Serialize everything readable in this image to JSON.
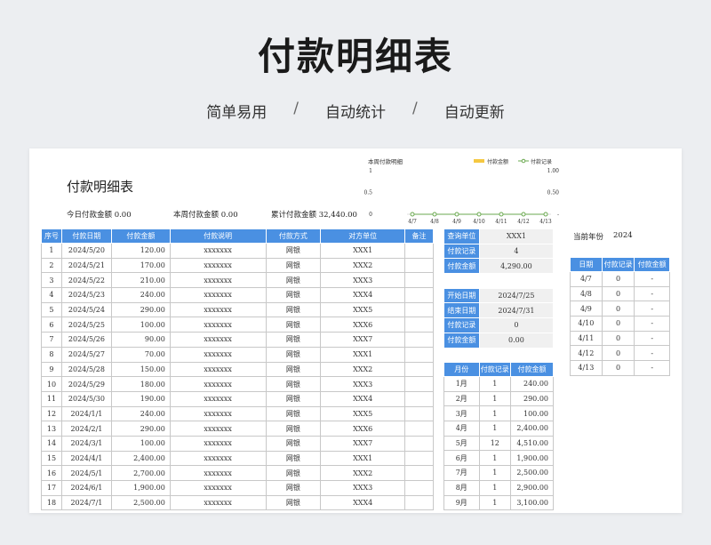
{
  "hero": {
    "title": "付款明细表"
  },
  "subtitle": {
    "items": [
      "简单易用",
      "自动统计",
      "自动更新"
    ],
    "sep": "/"
  },
  "sheet": {
    "title": "付款明细表",
    "stats": {
      "today": "今日付款金额 0.00",
      "week": "本周付款金额 0.00",
      "total": "累计付款金额 32,440.00"
    },
    "chart": {
      "title": "本周付款明细",
      "legend_amount": "付款金额",
      "legend_records": "付款记录",
      "left_ticks": [
        "1",
        "0.5",
        "0"
      ],
      "right_ticks": [
        "1.00",
        "0.50",
        "-"
      ],
      "colors": {
        "amount": "#f5c842",
        "records": "#6aa84f"
      }
    },
    "chart_data": {
      "type": "line",
      "categories": [
        "4/7",
        "4/8",
        "4/9",
        "4/10",
        "4/11",
        "4/12",
        "4/13"
      ],
      "series": [
        {
          "name": "付款金额",
          "values": [
            0,
            0,
            0,
            0,
            0,
            0,
            0
          ]
        },
        {
          "name": "付款记录",
          "values": [
            0,
            0,
            0,
            0,
            0,
            0,
            0
          ]
        }
      ],
      "title": "本周付款明细",
      "ylim": [
        0,
        1
      ]
    },
    "main_table": {
      "headers": [
        "序号",
        "付款日期",
        "付款金额",
        "付款说明",
        "付款方式",
        "对方单位",
        "备注"
      ],
      "rows": [
        [
          "1",
          "2024/5/20",
          "120.00",
          "xxxxxxx",
          "网银",
          "XXX1",
          ""
        ],
        [
          "2",
          "2024/5/21",
          "170.00",
          "xxxxxxx",
          "网银",
          "XXX2",
          ""
        ],
        [
          "3",
          "2024/5/22",
          "210.00",
          "xxxxxxx",
          "网银",
          "XXX3",
          ""
        ],
        [
          "4",
          "2024/5/23",
          "240.00",
          "xxxxxxx",
          "网银",
          "XXX4",
          ""
        ],
        [
          "5",
          "2024/5/24",
          "290.00",
          "xxxxxxx",
          "网银",
          "XXX5",
          ""
        ],
        [
          "6",
          "2024/5/25",
          "100.00",
          "xxxxxxx",
          "网银",
          "XXX6",
          ""
        ],
        [
          "7",
          "2024/5/26",
          "90.00",
          "xxxxxxx",
          "网银",
          "XXX7",
          ""
        ],
        [
          "8",
          "2024/5/27",
          "70.00",
          "xxxxxxx",
          "网银",
          "XXX1",
          ""
        ],
        [
          "9",
          "2024/5/28",
          "150.00",
          "xxxxxxx",
          "网银",
          "XXX2",
          ""
        ],
        [
          "10",
          "2024/5/29",
          "180.00",
          "xxxxxxx",
          "网银",
          "XXX3",
          ""
        ],
        [
          "11",
          "2024/5/30",
          "190.00",
          "xxxxxxx",
          "网银",
          "XXX4",
          ""
        ],
        [
          "12",
          "2024/1/1",
          "240.00",
          "xxxxxxx",
          "网银",
          "XXX5",
          ""
        ],
        [
          "13",
          "2024/2/1",
          "290.00",
          "xxxxxxx",
          "网银",
          "XXX6",
          ""
        ],
        [
          "14",
          "2024/3/1",
          "100.00",
          "xxxxxxx",
          "网银",
          "XXX7",
          ""
        ],
        [
          "15",
          "2024/4/1",
          "2,400.00",
          "xxxxxxx",
          "网银",
          "XXX1",
          ""
        ],
        [
          "16",
          "2024/5/1",
          "2,700.00",
          "xxxxxxx",
          "网银",
          "XXX2",
          ""
        ],
        [
          "17",
          "2024/6/1",
          "1,900.00",
          "xxxxxxx",
          "网银",
          "XXX3",
          ""
        ],
        [
          "18",
          "2024/7/1",
          "2,500.00",
          "xxxxxxx",
          "网银",
          "XXX4",
          ""
        ]
      ]
    },
    "query": {
      "rows": [
        [
          "查询单位",
          "XXX1"
        ],
        [
          "付款记录",
          "4"
        ],
        [
          "付款金额",
          "4,290.00"
        ],
        [
          "",
          ""
        ],
        [
          "开始日期",
          "2024/7/25"
        ],
        [
          "结束日期",
          "2024/7/31"
        ],
        [
          "付款记录",
          "0"
        ],
        [
          "付款金额",
          "0.00"
        ]
      ]
    },
    "monthly": {
      "headers": [
        "月份",
        "付款记录",
        "付款金额"
      ],
      "rows": [
        [
          "1月",
          "1",
          "240.00"
        ],
        [
          "2月",
          "1",
          "290.00"
        ],
        [
          "3月",
          "1",
          "100.00"
        ],
        [
          "4月",
          "1",
          "2,400.00"
        ],
        [
          "5月",
          "12",
          "4,510.00"
        ],
        [
          "6月",
          "1",
          "1,900.00"
        ],
        [
          "7月",
          "1",
          "2,500.00"
        ],
        [
          "8月",
          "1",
          "2,900.00"
        ],
        [
          "9月",
          "1",
          "3,100.00"
        ]
      ]
    },
    "year": {
      "label": "当前年份",
      "value": "2024"
    },
    "daily": {
      "headers": [
        "日期",
        "付款记录",
        "付款金额"
      ],
      "rows": [
        [
          "4/7",
          "0",
          "-"
        ],
        [
          "4/8",
          "0",
          "-"
        ],
        [
          "4/9",
          "0",
          "-"
        ],
        [
          "4/10",
          "0",
          "-"
        ],
        [
          "4/11",
          "0",
          "-"
        ],
        [
          "4/12",
          "0",
          "-"
        ],
        [
          "4/13",
          "0",
          "-"
        ]
      ]
    }
  }
}
